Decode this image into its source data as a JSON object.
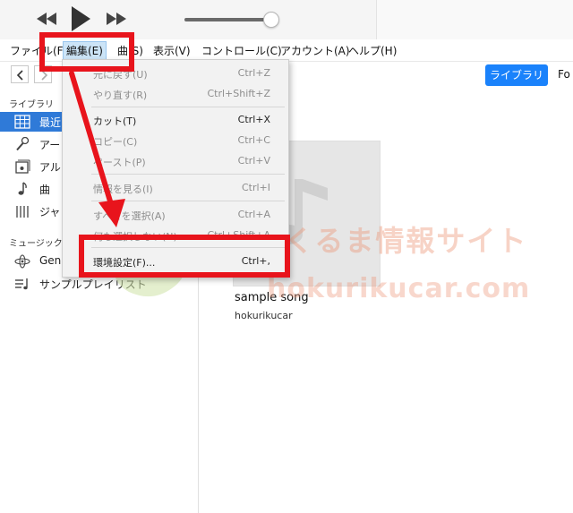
{
  "player": {
    "rewind_icon": "rewind-icon",
    "play_icon": "play-icon",
    "forward_icon": "fast-forward-icon",
    "volume_level": 0.9
  },
  "menubar": {
    "items": [
      {
        "label": "ファイル(F)"
      },
      {
        "label": "編集(E)"
      },
      {
        "label": "曲(S)"
      },
      {
        "label": "表示(V)"
      },
      {
        "label": "コントロール(C)"
      },
      {
        "label": "アカウント(A)"
      },
      {
        "label": "ヘルプ(H)"
      }
    ]
  },
  "toolbar": {
    "library_button": "ライブラリ",
    "for_text": "Fo"
  },
  "sidebar": {
    "library_header": "ライブラリ",
    "library_items": [
      {
        "label": "最近",
        "icon": "grid-icon"
      },
      {
        "label": "アー",
        "icon": "microphone-icon"
      },
      {
        "label": "アル",
        "icon": "album-icon"
      },
      {
        "label": "曲",
        "icon": "music-note-icon"
      },
      {
        "label": "ジャ",
        "icon": "guitar-icon"
      }
    ],
    "playlist_header": "ミュージックプ",
    "playlist_items": [
      {
        "label": "Gen",
        "icon": "genius-icon"
      },
      {
        "label": "サンプルプレイリスト",
        "icon": "playlist-icon"
      }
    ]
  },
  "main": {
    "song_title": "sample song",
    "artist": "hokurikucar"
  },
  "edit_menu": {
    "items": [
      {
        "label": "元に戻す(U)",
        "shortcut": "Ctrl+Z",
        "disabled": true
      },
      {
        "label": "やり直す(R)",
        "shortcut": "Ctrl+Shift+Z",
        "disabled": true
      },
      {
        "label": "カット(T)",
        "shortcut": "Ctrl+X",
        "disabled": false
      },
      {
        "label": "コピー(C)",
        "shortcut": "Ctrl+C",
        "disabled": true
      },
      {
        "label": "ペースト(P)",
        "shortcut": "Ctrl+V",
        "disabled": true
      },
      {
        "label": "情報を見る(I)",
        "shortcut": "Ctrl+I",
        "disabled": true
      },
      {
        "label": "すべてを選択(A)",
        "shortcut": "Ctrl+A",
        "disabled": true
      },
      {
        "label": "何も選択しない(N)",
        "shortcut": "Ctrl+Shift+A",
        "disabled": true
      },
      {
        "label": "環境設定(F)...",
        "shortcut": "Ctrl+,",
        "disabled": false
      }
    ]
  },
  "watermark": {
    "line1": "北陸くるま情報サイト",
    "line2": "hokurikucar.com"
  },
  "colors": {
    "accent": "#1a82fb",
    "sidebar_selected": "#2f7ad8",
    "annotation": "#e8141c"
  }
}
